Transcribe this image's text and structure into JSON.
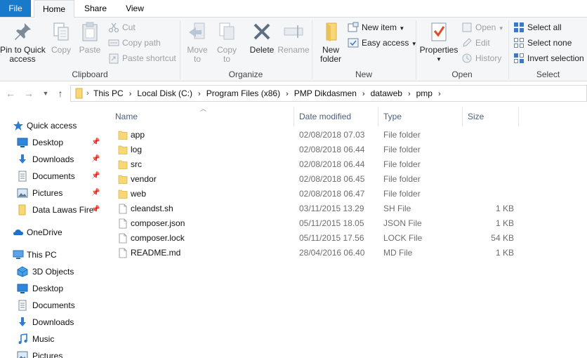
{
  "tabs": {
    "file": "File",
    "home": "Home",
    "share": "Share",
    "view": "View"
  },
  "ribbon": {
    "clipboard": {
      "label": "Clipboard",
      "pin_line1": "Pin to Quick",
      "pin_line2": "access",
      "copy": "Copy",
      "paste": "Paste",
      "cut": "Cut",
      "copy_path": "Copy path",
      "paste_shortcut": "Paste shortcut"
    },
    "organize": {
      "label": "Organize",
      "move_to_line1": "Move",
      "move_to_line2": "to",
      "copy_to_line1": "Copy",
      "copy_to_line2": "to",
      "delete": "Delete",
      "rename": "Rename"
    },
    "new": {
      "label": "New",
      "new_folder_line1": "New",
      "new_folder_line2": "folder",
      "new_item": "New item",
      "easy_access": "Easy access"
    },
    "open": {
      "label": "Open",
      "properties": "Properties",
      "open": "Open",
      "edit": "Edit",
      "history": "History"
    },
    "select": {
      "label": "Select",
      "select_all": "Select all",
      "select_none": "Select none",
      "invert_selection": "Invert selection"
    }
  },
  "breadcrumb": [
    "This PC",
    "Local Disk (C:)",
    "Program Files (x86)",
    "PMP Dikdasmen",
    "dataweb",
    "pmp"
  ],
  "nav": {
    "quick_access": "Quick access",
    "quick_items": [
      "Desktop",
      "Downloads",
      "Documents",
      "Pictures",
      "Data Lawas Fire"
    ],
    "onedrive": "OneDrive",
    "this_pc": "This PC",
    "pc_items": [
      "3D Objects",
      "Desktop",
      "Documents",
      "Downloads",
      "Music",
      "Pictures"
    ]
  },
  "columns": {
    "name": "Name",
    "date": "Date modified",
    "type": "Type",
    "size": "Size"
  },
  "files": [
    {
      "name": "app",
      "date": "02/08/2018 07.03",
      "type": "File folder",
      "size": "",
      "kind": "folder"
    },
    {
      "name": "log",
      "date": "02/08/2018 06.44",
      "type": "File folder",
      "size": "",
      "kind": "folder"
    },
    {
      "name": "src",
      "date": "02/08/2018 06.44",
      "type": "File folder",
      "size": "",
      "kind": "folder"
    },
    {
      "name": "vendor",
      "date": "02/08/2018 06.45",
      "type": "File folder",
      "size": "",
      "kind": "folder"
    },
    {
      "name": "web",
      "date": "02/08/2018 06.47",
      "type": "File folder",
      "size": "",
      "kind": "folder"
    },
    {
      "name": "cleandst.sh",
      "date": "03/11/2015 13.29",
      "type": "SH File",
      "size": "1 KB",
      "kind": "file"
    },
    {
      "name": "composer.json",
      "date": "05/11/2015 18.05",
      "type": "JSON File",
      "size": "1 KB",
      "kind": "file"
    },
    {
      "name": "composer.lock",
      "date": "05/11/2015 17.56",
      "type": "LOCK File",
      "size": "54 KB",
      "kind": "file"
    },
    {
      "name": "README.md",
      "date": "28/04/2016 06.40",
      "type": "MD File",
      "size": "1 KB",
      "kind": "file"
    }
  ],
  "colors": {
    "file_tab": "#1979ca",
    "folder": "#f8d775",
    "header_text": "#4c607a"
  }
}
